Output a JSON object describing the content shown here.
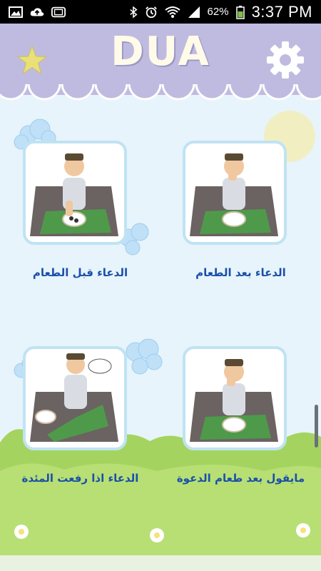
{
  "status_bar": {
    "battery_percent": "62%",
    "time": "3:37 PM",
    "left_icons": [
      "image-icon",
      "cloud-upload-icon",
      "tablet-icon"
    ],
    "right_icons": [
      "bluetooth-icon",
      "alarm-icon",
      "wifi-icon",
      "signal-icon",
      "battery-icon"
    ]
  },
  "header": {
    "title": "DUA",
    "left_icon": "star-icon",
    "right_icon": "settings-gear-icon",
    "background": "#bfbbe0"
  },
  "grid": {
    "items": [
      {
        "label": "الدعاء بعد الطعام",
        "image": "boy-after-eating-illustration"
      },
      {
        "label": "الدعاء قبل الطعام",
        "image": "boy-before-eating-illustration"
      },
      {
        "label": "مايقول بعد طعام الدعوة",
        "image": "boy-after-feast-illustration"
      },
      {
        "label": "الدعاء اذا رفعت المئدة",
        "image": "boy-lifting-tablecloth-illustration"
      }
    ],
    "label_color": "#1b4fa8"
  }
}
